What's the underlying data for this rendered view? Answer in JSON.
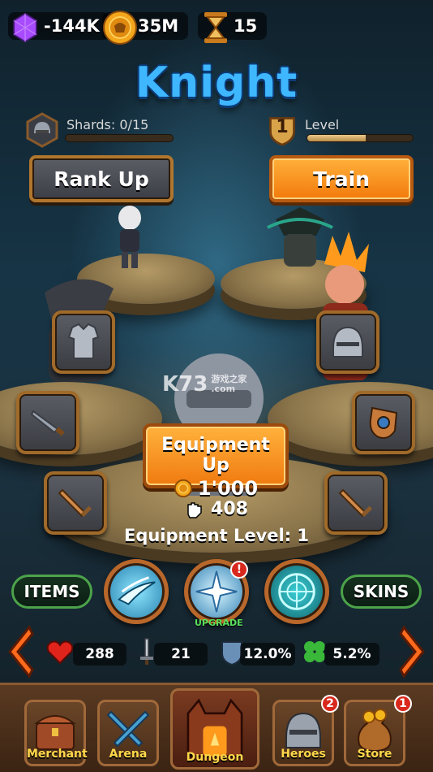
{
  "resources": {
    "gems": "-144K",
    "coins": "35M",
    "hourglass": "15"
  },
  "hero": {
    "name": "Knight"
  },
  "shards": {
    "label": "Shards: 0/15",
    "progress": 0.0
  },
  "level": {
    "value": "1",
    "label": "Level",
    "progress": 0.55
  },
  "buttons": {
    "rank_up": "Rank Up",
    "train": "Train",
    "equipment_up": "Equipment Up",
    "equipment_cost": "1'000",
    "items": "ITEMS",
    "skins": "SKINS"
  },
  "power": "408",
  "equipment_level": "Equipment Level: 1",
  "skills": {
    "upgrade_badge": "!",
    "upgrade_label": "UPGRADE"
  },
  "stats": {
    "health": "288",
    "attack": "21",
    "armor": "12.0%",
    "luck": "5.2%"
  },
  "nav": [
    {
      "label": "Merchant",
      "icon": "chest-icon",
      "badge": ""
    },
    {
      "label": "Arena",
      "icon": "crossed-swords-icon",
      "badge": ""
    },
    {
      "label": "Dungeon",
      "icon": "dungeon-gate-icon",
      "badge": ""
    },
    {
      "label": "Heroes",
      "icon": "helmet-icon",
      "badge": "2"
    },
    {
      "label": "Store",
      "icon": "coin-sack-icon",
      "badge": "1"
    }
  ],
  "watermark": {
    "logo": "K73",
    "site": "游戏之家",
    "domain": ".com"
  },
  "colors": {
    "title_blue": "#3fb7ff",
    "orange_button": "#f27a0c",
    "frame_bronze": "#a06a2a",
    "upgrade_green": "#58e05a",
    "badge_red": "#d9281c"
  }
}
